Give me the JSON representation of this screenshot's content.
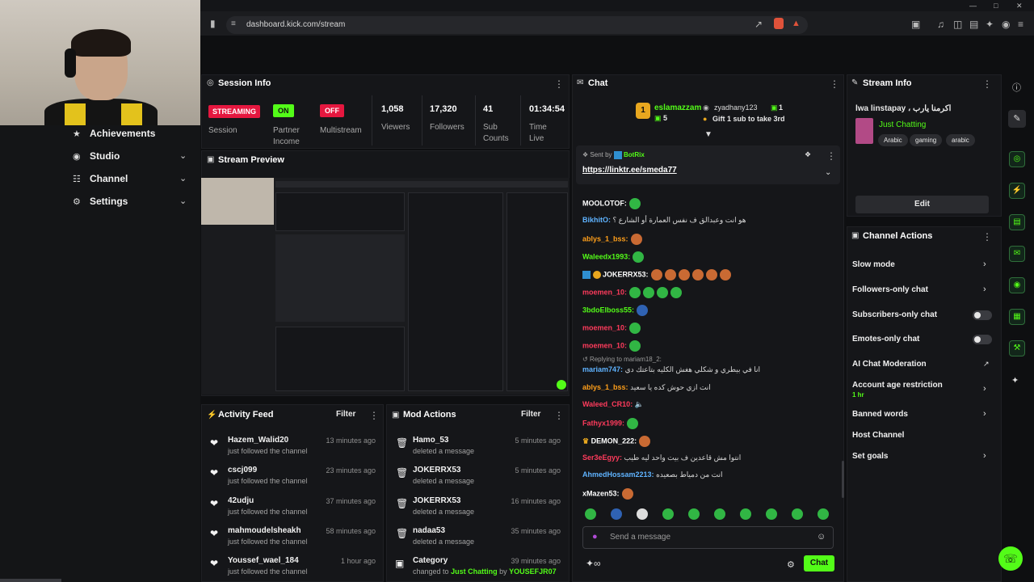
{
  "browser": {
    "url": "dashboard.kick.com/stream"
  },
  "nav": {
    "items": [
      {
        "label": "Achievements",
        "icon": "trophy-icon"
      },
      {
        "label": "Studio",
        "icon": "studio-icon"
      },
      {
        "label": "Channel",
        "icon": "channel-icon"
      },
      {
        "label": "Settings",
        "icon": "gear-icon"
      }
    ]
  },
  "session": {
    "title": "Session Info",
    "status": "STREAMING",
    "status_label": "Session",
    "partner": "ON",
    "partner_label": "Partner Income",
    "multistream": "OFF",
    "multistream_label": "Multistream",
    "viewers": "1,058",
    "viewers_label": "Viewers",
    "followers": "17,320",
    "followers_label": "Followers",
    "subs": "41",
    "subs_label": "Sub Counts",
    "time": "01:34:54",
    "time_label": "Time Live"
  },
  "preview": {
    "title": "Stream Preview"
  },
  "activity": {
    "title": "Activity Feed",
    "filter": "Filter",
    "items": [
      {
        "name": "Hazem_Walid20",
        "sub": "just followed the channel",
        "time": "13 minutes ago"
      },
      {
        "name": "cscj099",
        "sub": "just followed the channel",
        "time": "23 minutes ago"
      },
      {
        "name": "42udju",
        "sub": "just followed the channel",
        "time": "37 minutes ago"
      },
      {
        "name": "mahmoudelsheakh",
        "sub": "just followed the channel",
        "time": "58 minutes ago"
      },
      {
        "name": "Youssef_wael_184",
        "sub": "just followed the channel",
        "time": "1 hour ago"
      }
    ]
  },
  "mod": {
    "title": "Mod Actions",
    "filter": "Filter",
    "items": [
      {
        "name": "Hamo_53",
        "sub": "deleted a message",
        "time": "5 minutes ago"
      },
      {
        "name": "JOKERRX53",
        "sub": "deleted a message",
        "time": "5 minutes ago"
      },
      {
        "name": "JOKERRX53",
        "sub": "deleted a message",
        "time": "16 minutes ago"
      },
      {
        "name": "nadaa53",
        "sub": "deleted a message",
        "time": "35 minutes ago"
      },
      {
        "name": "Category",
        "sub": "changed to",
        "time": "39 minutes ago",
        "sub2": "Just Chatting",
        "sub3": "by",
        "sub4": "YOUSEFJR07"
      }
    ]
  },
  "chat": {
    "title": "Chat",
    "top_gifter": "eslamazzam",
    "top_count": "5",
    "gifter2": "zyadhany123",
    "gifter2_count": "1",
    "gift_cta": "Gift 1 sub to take 3rd",
    "pinned_by_prefix": "Sent by",
    "pinned_by": "BotRix",
    "pinned_link": "https://linktr.ee/smeda77",
    "replying": "Replying to mariam18_2:",
    "messages": [
      {
        "user": "MOOLOTOF:",
        "color": "#ffffff",
        "text": ""
      },
      {
        "user": "BikhitO:",
        "color": "#5fb3ff",
        "text": "هو انت وعبدالق ف نفس العمارة أو الشارع ؟"
      },
      {
        "user": "ablys_1_bss:",
        "color": "#ff9f1a",
        "text": ""
      },
      {
        "user": "Waleedx1993:",
        "color": "#53fc18",
        "text": ""
      },
      {
        "user": "JOKERRX53:",
        "color": "#ffffff",
        "text": ""
      },
      {
        "user": "moemen_10:",
        "color": "#ff3b5c",
        "text": ""
      },
      {
        "user": "3bdoElboss55:",
        "color": "#53fc18",
        "text": ""
      },
      {
        "user": "moemen_10:",
        "color": "#ff3b5c",
        "text": ""
      },
      {
        "user": "moemen_10:",
        "color": "#ff3b5c",
        "text": ""
      },
      {
        "user": "mariam747:",
        "color": "#5fb3ff",
        "text": "انا في بيطري و شكلي هغش الكليه بتاعتك دي"
      },
      {
        "user": "ablys_1_bss:",
        "color": "#ff9f1a",
        "text": "انت ازي حوش كده يا سعيد"
      },
      {
        "user": "Waleed_CR10:",
        "color": "#ff3b5c",
        "text": ""
      },
      {
        "user": "Fathyx1999:",
        "color": "#ff3b5c",
        "text": ""
      },
      {
        "user": "DEMON_222:",
        "color": "#ffffff",
        "text": ""
      },
      {
        "user": "Ser3eEgyy:",
        "color": "#ff3b5c",
        "text": "انتوا مش قاعدين ف بيت واحد ليه طيب"
      },
      {
        "user": "AhmedHossam2213:",
        "color": "#5fb3ff",
        "text": "انت من دمياط بصعيده"
      },
      {
        "user": "xMazen53:",
        "color": "#ffffff",
        "text": ""
      }
    ],
    "input_placeholder": "Send a message",
    "send": "Chat"
  },
  "stream_info": {
    "title": "Stream Info",
    "stream_title": "lwa linstapay ، اكرمنا يارب",
    "category": "Just Chatting",
    "tags": [
      "Arabic",
      "gaming",
      "arabic"
    ],
    "edit": "Edit"
  },
  "actions": {
    "title": "Channel Actions",
    "items": [
      {
        "label": "Slow mode",
        "control": "chevron"
      },
      {
        "label": "Followers-only chat",
        "control": "chevron"
      },
      {
        "label": "Subscribers-only chat",
        "control": "toggle"
      },
      {
        "label": "Emotes-only chat",
        "control": "toggle"
      },
      {
        "label": "AI Chat Moderation",
        "control": "external"
      },
      {
        "label": "Account age restriction",
        "sub": "1 hr",
        "control": "chevron"
      },
      {
        "label": "Banned words",
        "control": "chevron"
      },
      {
        "label": "Host Channel",
        "control": "none"
      },
      {
        "label": "Set goals",
        "control": "chevron"
      }
    ]
  },
  "colors": {
    "accent": "#53fc18",
    "streaming": "#e5173f",
    "off": "#e5173f"
  }
}
